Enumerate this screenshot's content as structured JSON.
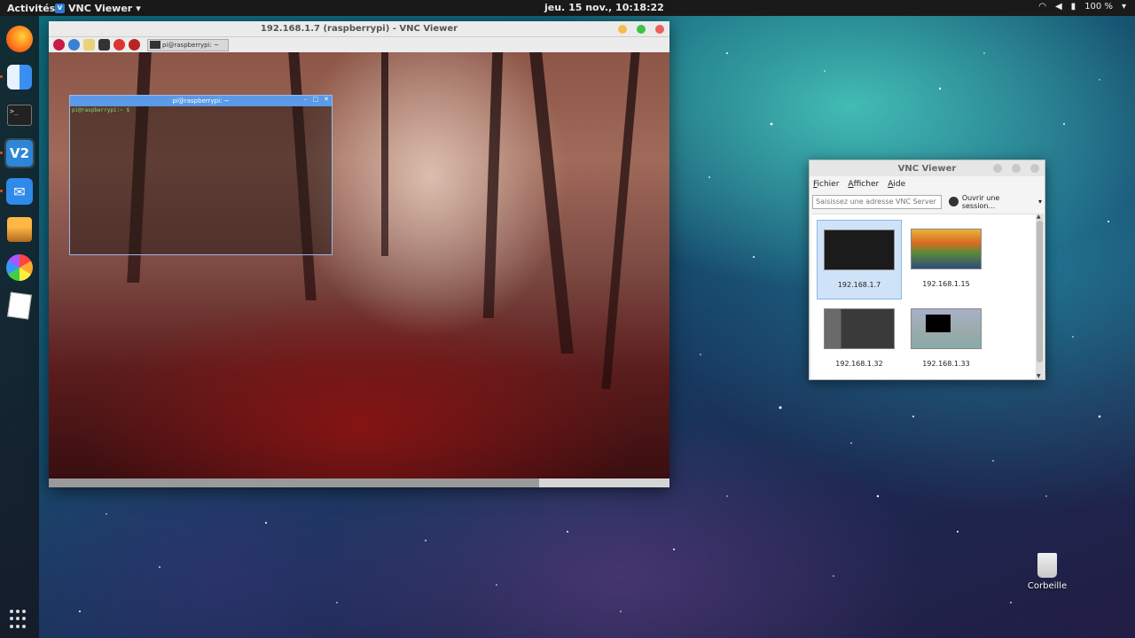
{
  "topbar": {
    "activities": "Activités",
    "app_name": "VNC Viewer",
    "app_arrow": "▾",
    "clock": "jeu. 15 nov., 10:18:22",
    "battery": "100 %",
    "icons": [
      "wifi-icon",
      "volume-icon",
      "battery-icon",
      "menu-arrow-icon"
    ]
  },
  "dock": {
    "items": [
      {
        "name": "firefox",
        "icon": "firefox-icon"
      },
      {
        "name": "files",
        "icon": "finder-icon"
      },
      {
        "name": "terminal",
        "icon": "terminal-icon",
        "label": ">_"
      },
      {
        "name": "vnc-viewer",
        "icon": "vnc-icon",
        "label": "V2"
      },
      {
        "name": "mail",
        "icon": "mail-icon"
      },
      {
        "name": "archive",
        "icon": "box-icon"
      },
      {
        "name": "photos",
        "icon": "photos-icon"
      },
      {
        "name": "notes",
        "icon": "notes-icon"
      }
    ]
  },
  "vnc_window": {
    "title": "192.168.1.7 (raspberrypi) - VNC Viewer",
    "taskbar_label": "pi@raspberrypi: ~",
    "terminal": {
      "title": "pi@raspberrypi: ~",
      "prompt": "pi@raspberrypi:~ $",
      "buttons": [
        "–",
        "□",
        "✕"
      ]
    }
  },
  "viewer": {
    "title": "VNC Viewer",
    "menu": [
      "Fichier",
      "Afficher",
      "Aide"
    ],
    "search_placeholder": "Saisissez une adresse VNC Server o",
    "session_label": "Ouvrir une session...",
    "session_arrow": "▾",
    "connections": [
      {
        "label": "192.168.1.7",
        "selected": true
      },
      {
        "label": "192.168.1.15",
        "selected": false
      },
      {
        "label": "192.168.1.32",
        "selected": false
      },
      {
        "label": "192.168.1.33",
        "selected": false
      }
    ]
  },
  "desktop": {
    "trash_label": "Corbeille"
  },
  "colors": {
    "accent_orange": "#e95420",
    "vnc_blue": "#2d86d8",
    "selection_blue": "#cfe3f8"
  }
}
